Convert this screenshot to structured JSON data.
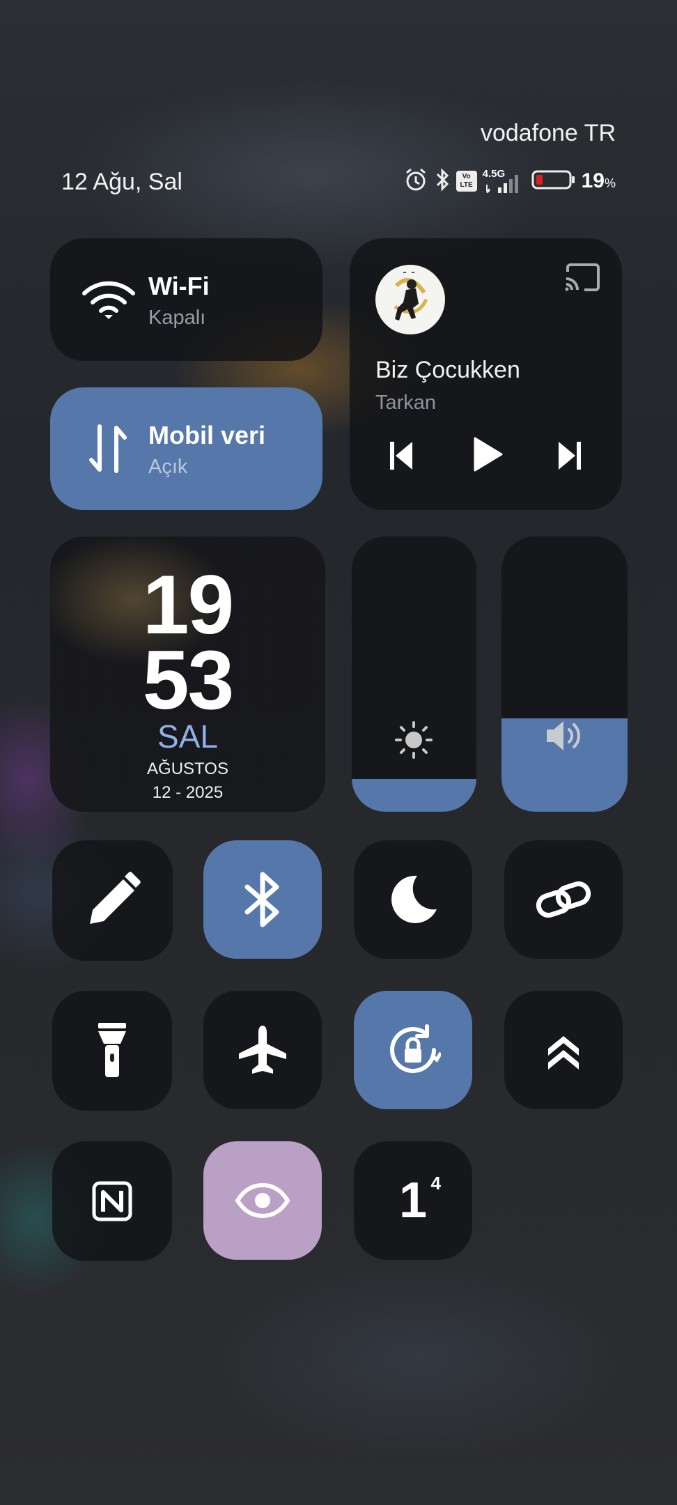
{
  "status": {
    "carrier": "vodafone TR",
    "date": "12 Ağu, Sal",
    "network": "4.5G",
    "volte": "Vo LTE",
    "battery_percent": "19",
    "battery_unit": "%"
  },
  "wifi": {
    "title": "Wi-Fi",
    "state": "Kapalı"
  },
  "mobile_data": {
    "title": "Mobil veri",
    "state": "Açık"
  },
  "media": {
    "title": "Biz Çocukken",
    "artist": "Tarkan"
  },
  "clock": {
    "hour": "19",
    "minute": "53",
    "day": "SAL",
    "month": "AĞUSTOS",
    "date": "12 - 2025"
  },
  "brightness": {
    "level": 0.12,
    "icon": "sun-icon"
  },
  "volume": {
    "level": 0.34,
    "icon": "speaker-icon"
  },
  "toggles": [
    {
      "name": "edit",
      "icon": "pencil-icon",
      "active": false
    },
    {
      "name": "bluetooth",
      "icon": "bluetooth-icon",
      "active": true
    },
    {
      "name": "do-not-disturb",
      "icon": "moon-icon",
      "active": false
    },
    {
      "name": "link",
      "icon": "link-icon",
      "active": false
    },
    {
      "name": "flashlight",
      "icon": "flashlight-icon",
      "active": false
    },
    {
      "name": "airplane-mode",
      "icon": "airplane-icon",
      "active": false
    },
    {
      "name": "rotation-lock",
      "icon": "rotation-lock-icon",
      "active": true
    },
    {
      "name": "chevrons-up",
      "icon": "double-chevron-up-icon",
      "active": false
    },
    {
      "name": "nfc",
      "icon": "nfc-icon",
      "active": false
    },
    {
      "name": "eye-comfort",
      "icon": "eye-icon",
      "active": true
    },
    {
      "name": "one-hand",
      "icon": "one-superscript-four-icon",
      "active": false,
      "label": "1",
      "sup": "4"
    }
  ],
  "colors": {
    "accent_blue": "#5577aa",
    "eye_active": "#bba0c6",
    "tile_dark": "#121316"
  }
}
